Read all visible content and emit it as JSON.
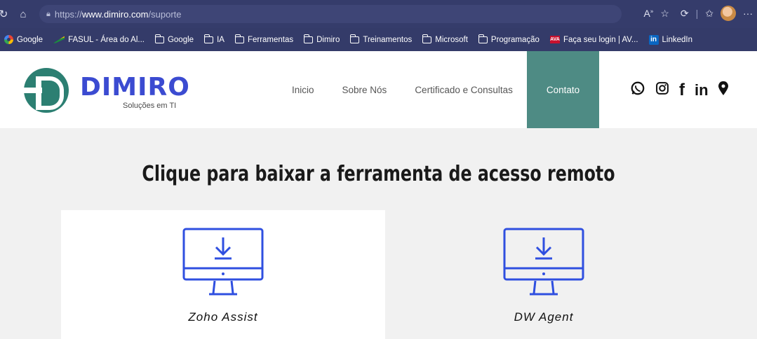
{
  "browser": {
    "url_prefix": "https://",
    "url_host": "www.dimiro.com",
    "url_path": "/suporte"
  },
  "bookmarks": [
    {
      "label": "Google",
      "icon": "google-icon"
    },
    {
      "label": "FASUL - Área do Al...",
      "icon": "fasul-icon"
    },
    {
      "label": "Google",
      "icon": "folder-icon"
    },
    {
      "label": "IA",
      "icon": "folder-icon"
    },
    {
      "label": "Ferramentas",
      "icon": "folder-icon"
    },
    {
      "label": "Dimiro",
      "icon": "folder-icon"
    },
    {
      "label": "Treinamentos",
      "icon": "folder-icon"
    },
    {
      "label": "Microsoft",
      "icon": "folder-icon"
    },
    {
      "label": "Programação",
      "icon": "folder-icon"
    },
    {
      "label": "Faça seu login | AV...",
      "icon": "ava-icon"
    },
    {
      "label": "LinkedIn",
      "icon": "linkedin-icon"
    }
  ],
  "site": {
    "logo_text": "DIMIRO",
    "logo_sub": "Soluções em TI",
    "menu": [
      "Inicio",
      "Sobre Nós",
      "Certificado e Consultas",
      "Contato"
    ],
    "active_menu": "Contato",
    "accent": "#4e8b84",
    "brand_blue": "#3b4bd1"
  },
  "main": {
    "title": "Clique para baixar a ferramenta de acesso remoto",
    "downloads": [
      {
        "label": "Zoho Assist"
      },
      {
        "label": "DW Agent"
      }
    ]
  }
}
